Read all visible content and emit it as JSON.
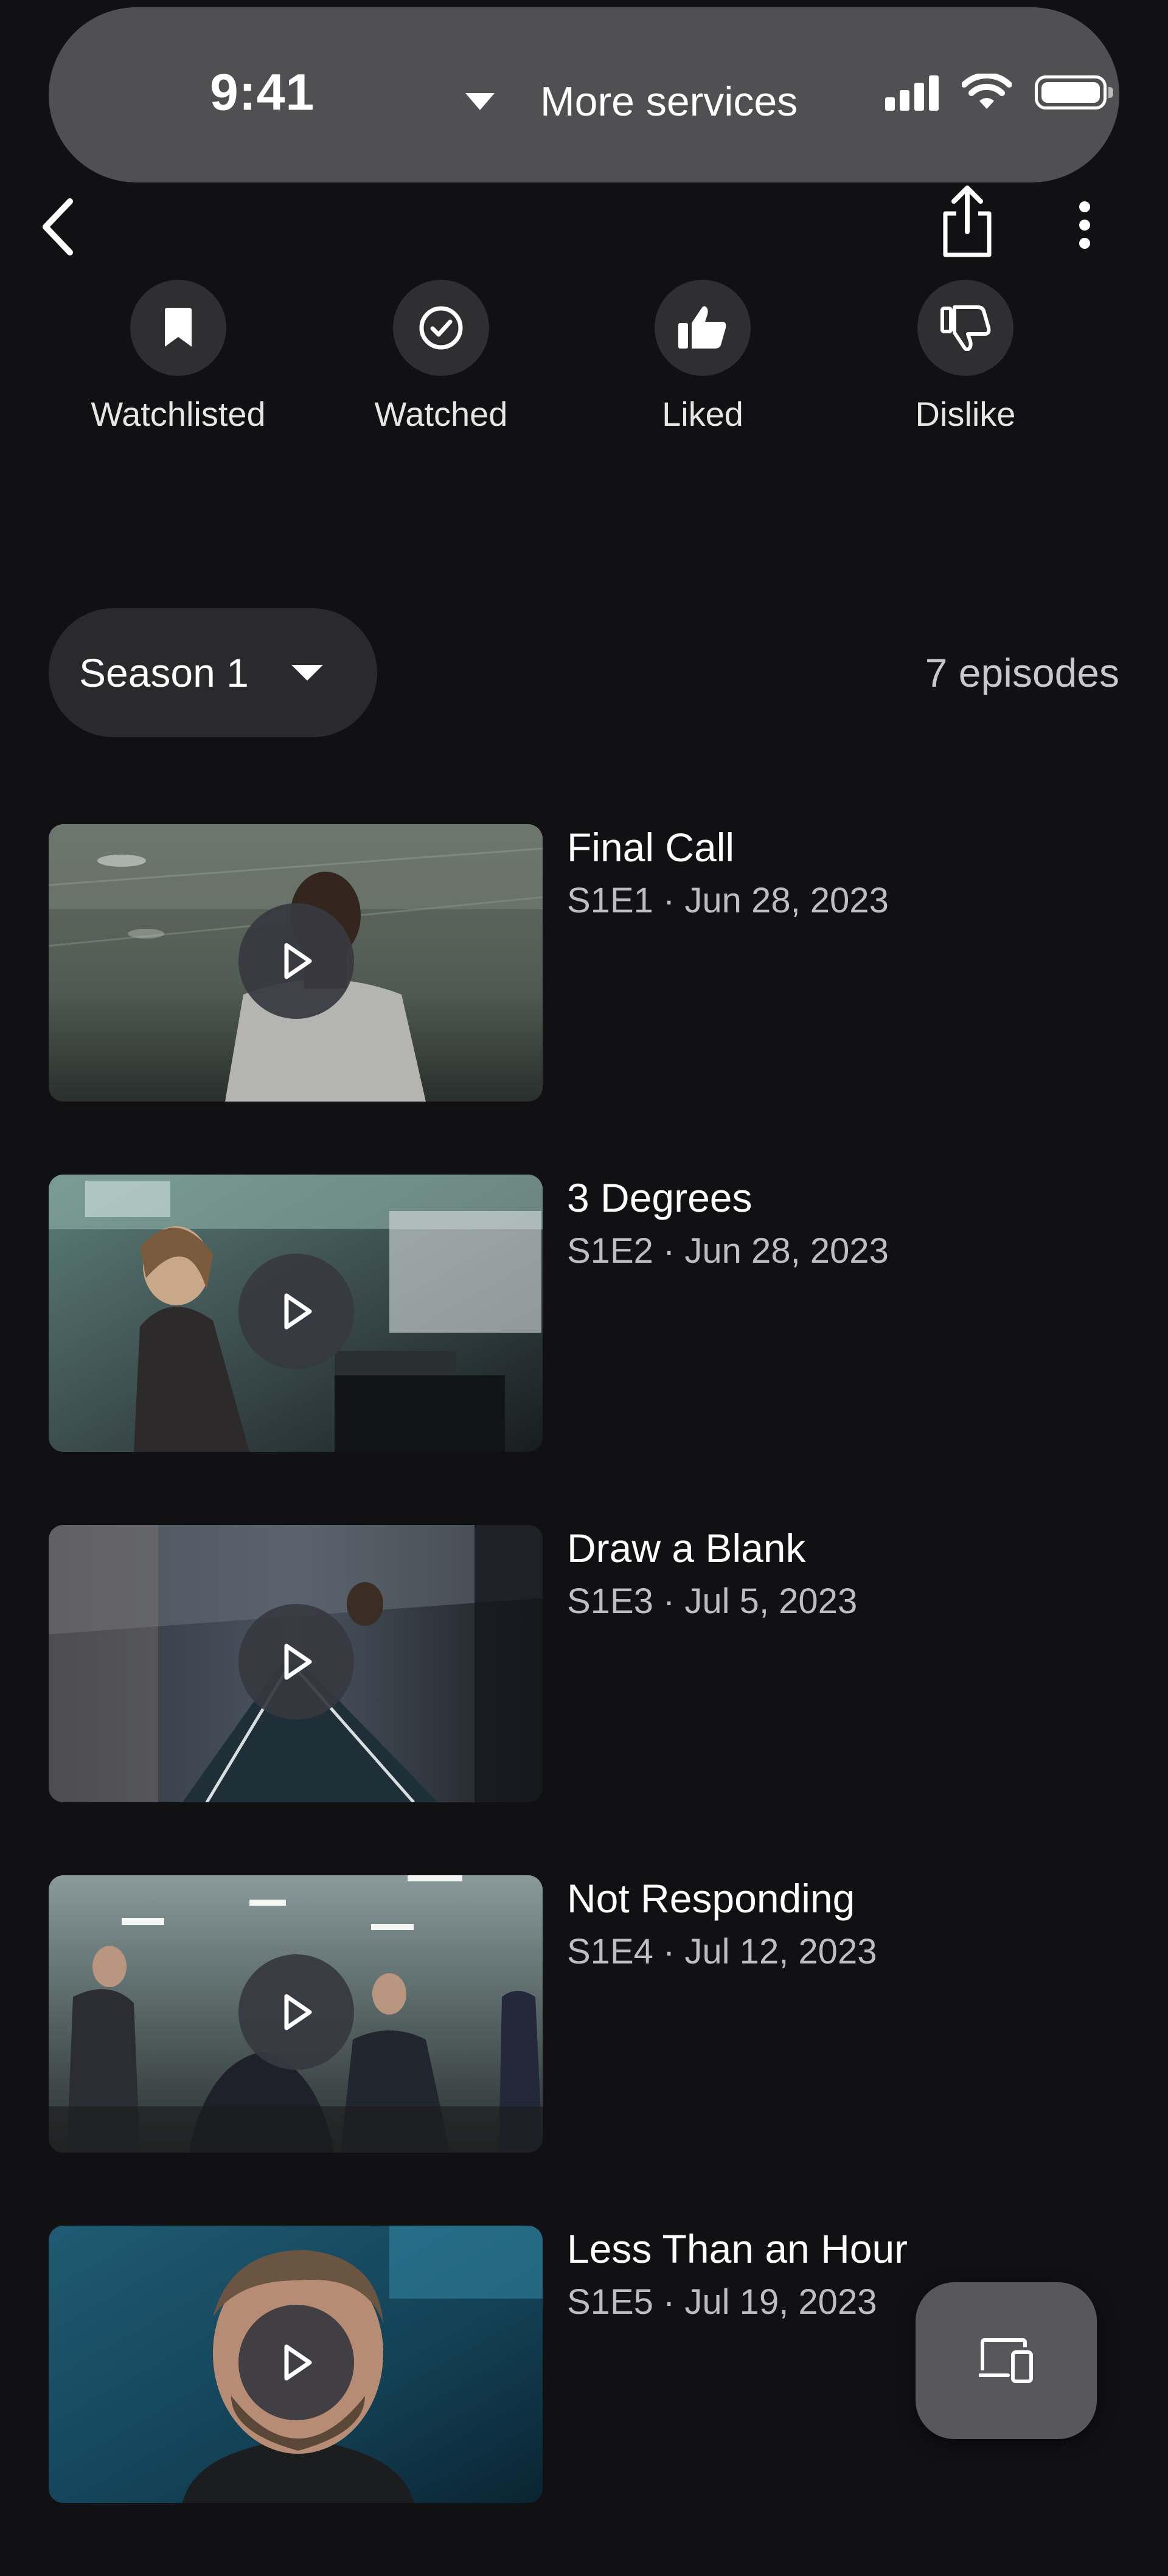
{
  "status_bar": {
    "time": "9:41",
    "service_label": "More services"
  },
  "nav": {
    "back_icon": "chevron-left-icon",
    "share_icon": "share-icon",
    "more_icon": "more-vertical-icon"
  },
  "actions": [
    {
      "label": "Watchlisted",
      "icon": "bookmark-icon"
    },
    {
      "label": "Watched",
      "icon": "check-circle-icon"
    },
    {
      "label": "Liked",
      "icon": "thumbs-up-icon"
    },
    {
      "label": "Dislike",
      "icon": "thumbs-down-icon"
    }
  ],
  "season": {
    "selected": "Season 1",
    "episode_count": "7 episodes"
  },
  "episodes": [
    {
      "title": "Final Call",
      "meta": "S1E1 · Jun 28, 2023"
    },
    {
      "title": "3 Degrees",
      "meta": "S1E2 · Jun 28, 2023"
    },
    {
      "title": "Draw a Blank",
      "meta": "S1E3 · Jul 5, 2023"
    },
    {
      "title": "Not Responding",
      "meta": "S1E4 · Jul 12, 2023"
    },
    {
      "title": "Less Than an Hour",
      "meta": "S1E5 · Jul 19, 2023"
    }
  ],
  "colors": {
    "background": "#111013",
    "pill": "#505052",
    "action_circle": "#2f2e31",
    "season_pill": "#2a292c",
    "secondary_text": "#bdbdc2"
  },
  "floating": {
    "icon": "cast-devices-icon"
  }
}
